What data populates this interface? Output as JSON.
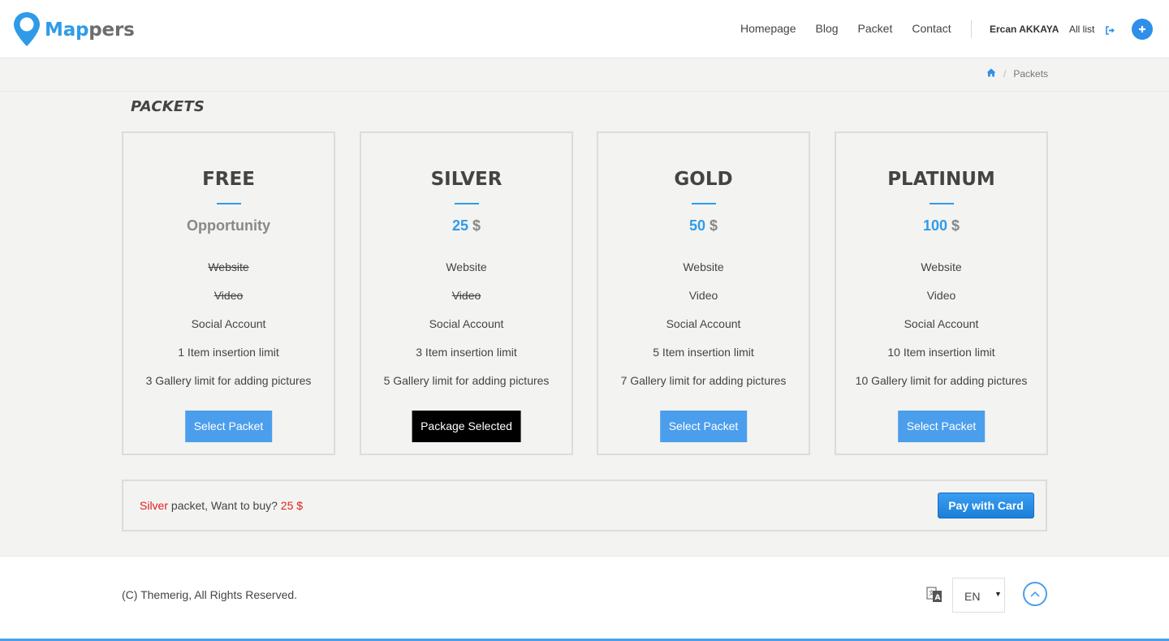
{
  "header": {
    "logo": {
      "part1": "Map",
      "part2": "pers"
    },
    "nav": [
      "Homepage",
      "Blog",
      "Packet",
      "Contact"
    ],
    "user_name": "Ercan AKKAYA",
    "all_list": "All list",
    "icons": {
      "logo": "map-pin-icon",
      "logout": "sign-out-icon",
      "add": "plus-icon"
    }
  },
  "breadcrumb": {
    "home_icon": "home-icon",
    "current": "Packets"
  },
  "page_title": "PACKETS",
  "packets": [
    {
      "name": "FREE",
      "price_text": "Opportunity",
      "price": "",
      "currency": "",
      "features": [
        {
          "text": "Website",
          "available": false
        },
        {
          "text": "Video",
          "available": false
        },
        {
          "text": "Social Account",
          "available": true
        },
        {
          "text": "1 Item insertion limit",
          "available": true
        },
        {
          "text": "3 Gallery limit for adding pictures",
          "available": true
        }
      ],
      "button": "Select Packet",
      "selected": false
    },
    {
      "name": "SILVER",
      "price_text": "",
      "price": "25",
      "currency": "$",
      "features": [
        {
          "text": "Website",
          "available": true
        },
        {
          "text": "Video",
          "available": false
        },
        {
          "text": "Social Account",
          "available": true
        },
        {
          "text": "3 Item insertion limit",
          "available": true
        },
        {
          "text": "5 Gallery limit for adding pictures",
          "available": true
        }
      ],
      "button": "Package Selected",
      "selected": true
    },
    {
      "name": "GOLD",
      "price_text": "",
      "price": "50",
      "currency": "$",
      "features": [
        {
          "text": "Website",
          "available": true
        },
        {
          "text": "Video",
          "available": true
        },
        {
          "text": "Social Account",
          "available": true
        },
        {
          "text": "5 Item insertion limit",
          "available": true
        },
        {
          "text": "7 Gallery limit for adding pictures",
          "available": true
        }
      ],
      "button": "Select Packet",
      "selected": false
    },
    {
      "name": "PLATINUM",
      "price_text": "",
      "price": "100",
      "currency": "$",
      "features": [
        {
          "text": "Website",
          "available": true
        },
        {
          "text": "Video",
          "available": true
        },
        {
          "text": "Social Account",
          "available": true
        },
        {
          "text": "10 Item insertion limit",
          "available": true
        },
        {
          "text": "10 Gallery limit for adding pictures",
          "available": true
        }
      ],
      "button": "Select Packet",
      "selected": false
    }
  ],
  "buy_bar": {
    "packet": "Silver",
    "middle_text": " packet, Want to buy? ",
    "price": "25 $",
    "pay_button": "Pay with Card"
  },
  "footer": {
    "copyright": "(C) Themerig, All Rights Reserved.",
    "language": "EN",
    "icons": {
      "translate": "translate-icon",
      "scroll_top": "chevron-up-icon"
    }
  },
  "colors": {
    "accent": "#2f9be8",
    "button": "#4b9eec",
    "selected_button": "#000000",
    "highlight_red": "#e0201c"
  }
}
